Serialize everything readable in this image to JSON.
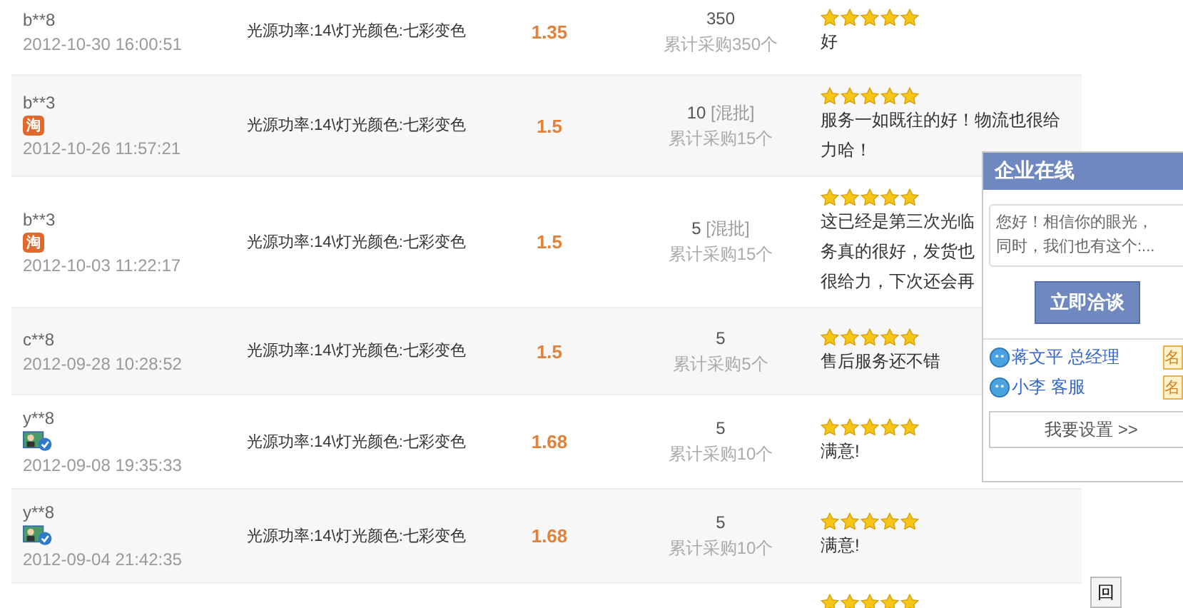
{
  "rows": [
    {
      "buyer": "b**8",
      "date": "2012-10-30 16:00:51",
      "spec": "光源功率:14\\灯光颜色:七彩变色",
      "price": "1.35",
      "quantity": "350",
      "batch": "",
      "total": "累计采购350个",
      "stars": 5,
      "review_lines": [
        "好"
      ]
    },
    {
      "buyer": "b**3",
      "badge": {
        "kind": "taobao",
        "text": "淘"
      },
      "date": "2012-10-26 11:57:21",
      "spec": "光源功率:14\\灯光颜色:七彩变色",
      "price": "1.5",
      "quantity": "10",
      "batch": "[混批]",
      "total": "累计采购15个",
      "stars": 5,
      "review_lines": [
        "服务一如既往的好！物流也很给",
        "力哈！"
      ]
    },
    {
      "buyer": "b**3",
      "badge": {
        "kind": "taobao",
        "text": "淘"
      },
      "date": "2012-10-03 11:22:17",
      "spec": "光源功率:14\\灯光颜色:七彩变色",
      "price": "1.5",
      "quantity": "5",
      "batch": "[混批]",
      "total": "累计采购15个",
      "stars": 5,
      "review_lines": [
        "这已经是第三次光临",
        "务真的很好，发货也",
        "很给力，下次还会再"
      ]
    },
    {
      "buyer": "c**8",
      "date": "2012-09-28 10:28:52",
      "spec": "光源功率:14\\灯光颜色:七彩变色",
      "price": "1.5",
      "quantity": "5",
      "batch": "",
      "total": "累计采购5个",
      "stars": 5,
      "review_lines": [
        "售后服务还不错"
      ]
    },
    {
      "buyer": "y**8",
      "badge": {
        "kind": "verified"
      },
      "date": "2012-09-08 19:35:33",
      "spec": "光源功率:14\\灯光颜色:七彩变色",
      "price": "1.68",
      "quantity": "5",
      "batch": "",
      "total": "累计采购10个",
      "stars": 5,
      "review_lines": [
        "满意!"
      ]
    },
    {
      "buyer": "y**8",
      "badge": {
        "kind": "verified"
      },
      "date": "2012-09-04 21:42:35",
      "spec": "光源功率:14\\灯光颜色:七彩变色",
      "price": "1.68",
      "quantity": "5",
      "batch": "",
      "total": "累计采购10个",
      "stars": 5,
      "review_lines": [
        "满意!"
      ]
    }
  ],
  "partial_row": {
    "stars": 5
  },
  "chat_panel": {
    "title": "企业在线",
    "greeting_lines": [
      "您好！相信你的眼光，",
      "同时，我们也有这个:..."
    ],
    "button": "立即洽谈",
    "contacts": [
      {
        "name": "蒋文平 总经理",
        "tag": "名"
      },
      {
        "name": "小李 客服",
        "tag": "名"
      }
    ],
    "footer": "我要设置 >>"
  },
  "back_to_top": "回"
}
